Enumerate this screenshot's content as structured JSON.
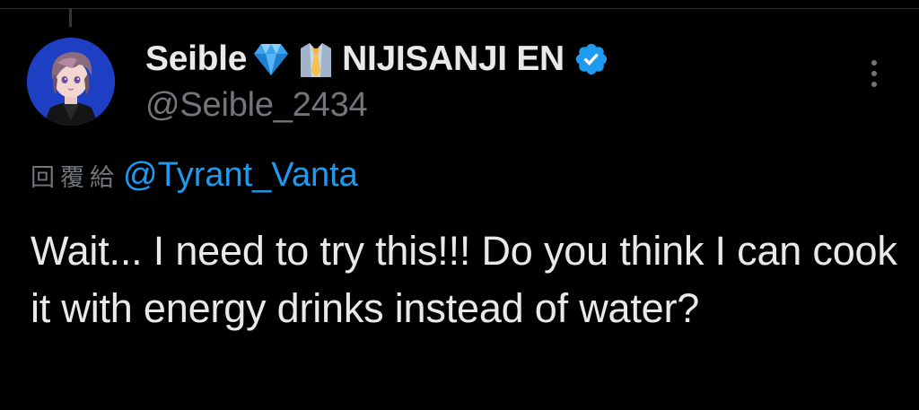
{
  "tweet": {
    "author": {
      "display_name": "Seible",
      "badge_emojis": [
        "gem-stone",
        "necktie-shirt"
      ],
      "org_name": "NIJISANJI EN",
      "verified": true,
      "handle": "@Seible_2434"
    },
    "reply": {
      "prefix": "回覆給",
      "mention": "@Tyrant_Vanta"
    },
    "text": "Wait... I need to try this!!! Do you think I can cook it with energy drinks instead of water?",
    "more_icon": "more-vertical-icon"
  },
  "colors": {
    "background": "#000000",
    "text_primary": "#e7e9ea",
    "text_secondary": "#71767b",
    "accent": "#1d9bf0"
  }
}
